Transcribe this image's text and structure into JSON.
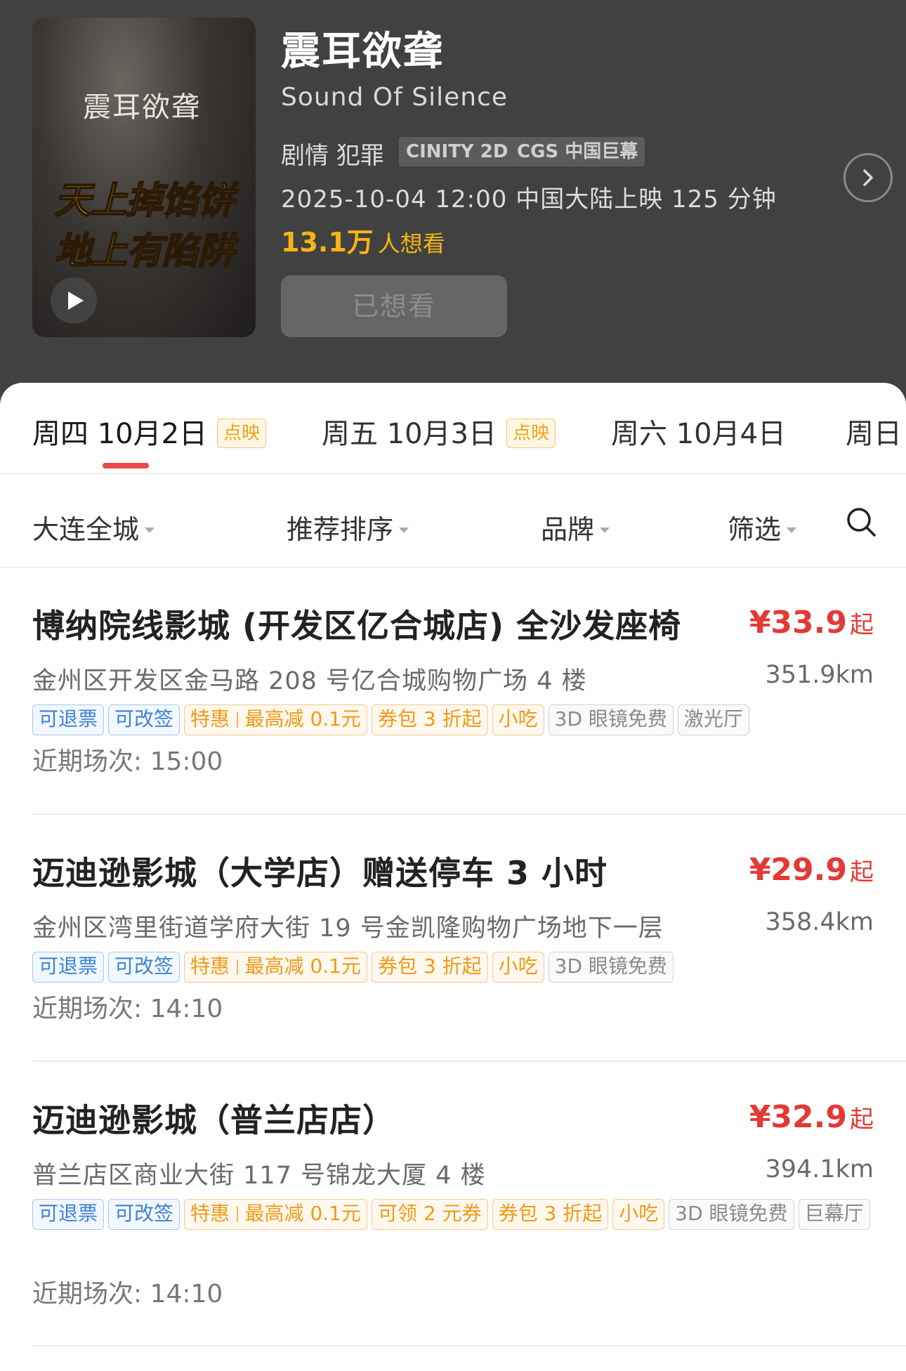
{
  "movie": {
    "poster_title": "震耳欲聋",
    "poster_slogan_1": "天上掉馅饼",
    "poster_slogan_2": "地上有陷阱",
    "title": "震耳欲聋",
    "subtitle": "Sound Of Silence",
    "genres": "剧情 犯罪",
    "badges": [
      "CINITY 2D",
      "CGS 中国巨幕"
    ],
    "release_info": "2025-10-04 12:00 中国大陆上映 125 分钟",
    "want_count": "13.1万",
    "want_suffix": "人想看",
    "want_button": "已想看",
    "colors": {
      "header_bg": "#414141",
      "accent": "#f7b413",
      "price": "#e53935"
    }
  },
  "dates": [
    {
      "label": "周四 10月2日",
      "tag": "点映",
      "active": true
    },
    {
      "label": "周五 10月3日",
      "tag": "点映",
      "active": false
    },
    {
      "label": "周六 10月4日",
      "tag": "",
      "active": false
    },
    {
      "label": "周日",
      "tag": "",
      "active": false
    }
  ],
  "filters": {
    "city": "大连全城",
    "sort": "推荐排序",
    "brand": "品牌",
    "filter": "筛选",
    "search_icon": "search-icon"
  },
  "cinemas": [
    {
      "name": "博纳院线影城 (开发区亿合城店) 全沙发座椅",
      "price": "¥33.9",
      "price_suffix": "起",
      "address": "金州区开发区金马路 208 号亿合城购物广场 4 楼",
      "distance": "351.9km",
      "tags": {
        "refund": "可退票",
        "change": "可改签",
        "deal_a": "特惠",
        "deal_b": "最高减 0.1元",
        "coupon_pack": "券包 3 折起",
        "snack": "小吃",
        "glasses": "3D 眼镜免费",
        "laser": "激光厅"
      },
      "recent": "近期场次: 15:00"
    },
    {
      "name": "迈迪逊影城（大学店）赠送停车 3 小时",
      "price": "¥29.9",
      "price_suffix": "起",
      "address": "金州区湾里街道学府大街 19 号金凯隆购物广场地下一层",
      "distance": "358.4km",
      "tags": {
        "refund": "可退票",
        "change": "可改签",
        "deal_a": "特惠",
        "deal_b": "最高减 0.1元",
        "coupon_pack": "券包 3 折起",
        "snack": "小吃",
        "glasses": "3D 眼镜免费"
      },
      "recent": "近期场次: 14:10"
    },
    {
      "name": "迈迪逊影城（普兰店店）",
      "price": "¥32.9",
      "price_suffix": "起",
      "address": "普兰店区商业大街 117 号锦龙大厦 4 楼",
      "distance": "394.1km",
      "tags": {
        "refund": "可退票",
        "change": "可改签",
        "deal_a": "特惠",
        "deal_b": "最高减 0.1元",
        "coupon": "可领 2 元券",
        "coupon_pack": "券包 3 折起",
        "snack": "小吃",
        "glasses": "3D 眼镜免费",
        "imax": "巨幕厅"
      },
      "recent": "近期场次: 14:10"
    }
  ]
}
